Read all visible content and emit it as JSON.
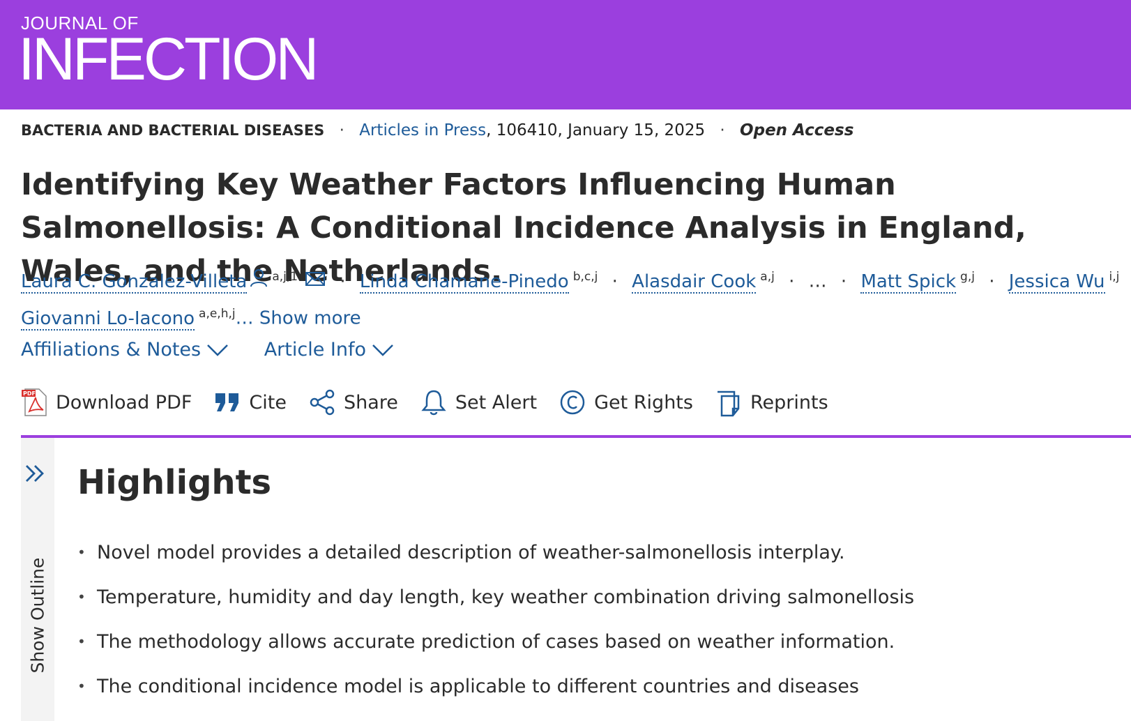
{
  "journal": {
    "line1": "JOURNAL OF",
    "line2": "INFECTION"
  },
  "meta": {
    "section": "BACTERIA AND BACTERIAL DISEASES",
    "articles_link": "Articles in Press",
    "details": ", 106410, January 15, 2025",
    "access": "Open Access",
    "separator": "·"
  },
  "article": {
    "title": "Identifying Key Weather Factors Influencing Human Salmonellosis: A Conditional Incidence Analysis in England, Wales, and the Netherlands."
  },
  "authors": [
    {
      "name": "Laura C. Gonzalez-Villeta",
      "sup": "a,j,1"
    },
    {
      "name": "Linda Chamane-Pinedo",
      "sup": "b,c,j"
    },
    {
      "name": "Alasdair Cook",
      "sup": "a,j"
    },
    {
      "name": "Matt Spick",
      "sup": "g,j"
    },
    {
      "name": "Jessica Wu",
      "sup": "i,j"
    },
    {
      "name": "Giovanni Lo-Iacono",
      "sup": "a,e,h,j"
    }
  ],
  "authors_ellipsis": "…",
  "show_more": "… Show more",
  "toggles": {
    "affiliations": "Affiliations & Notes",
    "article_info": "Article Info"
  },
  "toolbar": {
    "download_pdf": "Download PDF",
    "cite": "Cite",
    "share": "Share",
    "set_alert": "Set Alert",
    "get_rights": "Get Rights",
    "reprints": "Reprints"
  },
  "outline": {
    "label": "Show Outline"
  },
  "highlights": {
    "title": "Highlights",
    "items": [
      "Novel model provides a detailed description of weather-salmonellosis interplay.",
      "Temperature, humidity and day length, key weather combination driving salmonellosis",
      "The methodology allows accurate prediction of cases based on weather information.",
      "The conditional incidence model is applicable to different countries and diseases"
    ]
  },
  "colors": {
    "brand": "#9b3fde",
    "link": "#1e5b99",
    "text": "#2b2b2b"
  }
}
